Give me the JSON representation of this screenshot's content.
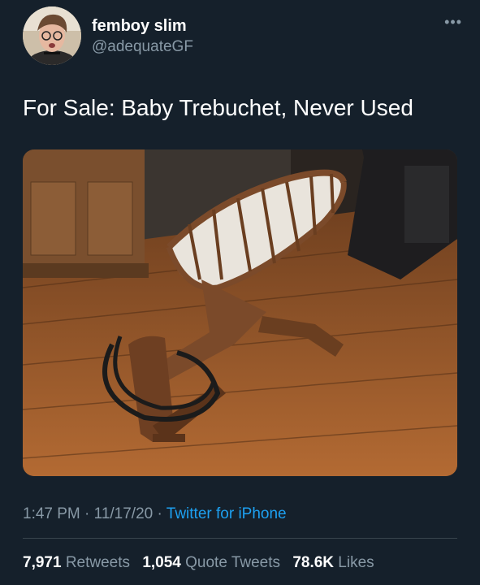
{
  "author": {
    "display_name": "femboy slim",
    "handle": "@adequateGF",
    "avatar_icon": "profile-photo"
  },
  "more_icon": "more-dots-icon",
  "tweet": {
    "text": "For Sale: Baby Trebuchet, Never Used"
  },
  "meta": {
    "time": "1:47 PM",
    "separator1": " · ",
    "date": "11/17/20",
    "separator2": " · ",
    "source": "Twitter for iPhone"
  },
  "stats": {
    "retweets_count": "7,971",
    "retweets_label": "Retweets",
    "quote_count": "1,054",
    "quote_label": "Quote Tweets",
    "likes_count": "78.6K",
    "likes_label": "Likes"
  },
  "colors": {
    "background": "#15202b",
    "text_primary": "#ffffff",
    "text_secondary": "#8899a6",
    "link": "#1da1f2",
    "divider": "#38444d"
  }
}
